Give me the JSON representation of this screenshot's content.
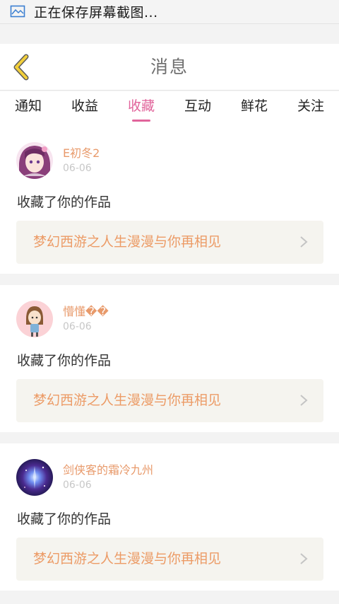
{
  "statusbar": {
    "text": "正在保存屏幕截图...",
    "icon": "screenshot-icon"
  },
  "header": {
    "title": "消息",
    "back_icon": "chevron-left-icon"
  },
  "tabs": [
    {
      "label": "通知",
      "active": false
    },
    {
      "label": "收益",
      "active": false
    },
    {
      "label": "收藏",
      "active": true
    },
    {
      "label": "互动",
      "active": false
    },
    {
      "label": "鲜花",
      "active": false
    },
    {
      "label": "关注",
      "active": false
    }
  ],
  "colors": {
    "accent": "#e1649b",
    "username": "#e89a6b",
    "work_title": "#ec9b66",
    "back_arrow": "#f2cf3b"
  },
  "messages": [
    {
      "username": "E初冬2",
      "date": "06-06",
      "action": "收藏了你的作品",
      "work_title": "梦幻西游之人生漫漫与你再相见"
    },
    {
      "username": "懵懂��",
      "date": "06-06",
      "action": "收藏了你的作品",
      "work_title": "梦幻西游之人生漫漫与你再相见"
    },
    {
      "username": "剑侠客的霜冷九州",
      "date": "06-06",
      "action": "收藏了你的作品",
      "work_title": "梦幻西游之人生漫漫与你再相见"
    }
  ]
}
